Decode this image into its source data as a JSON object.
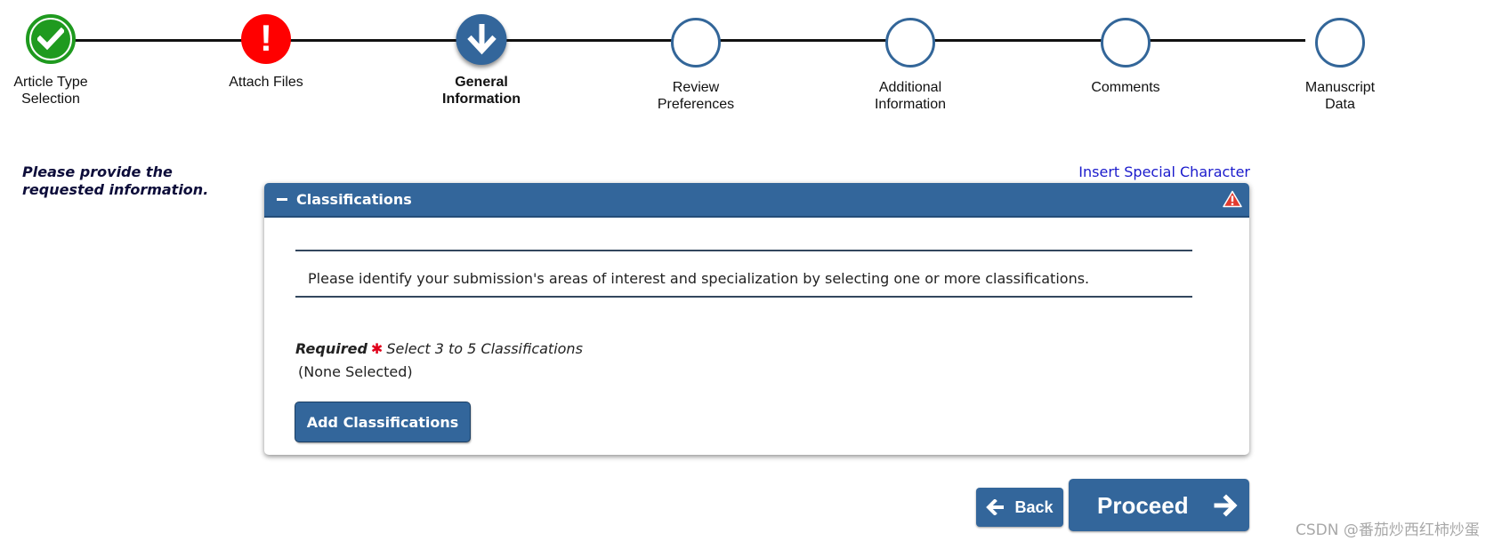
{
  "stepper": {
    "steps": [
      {
        "label_1": "Article Type",
        "label_2": "Selection",
        "status": "complete",
        "icon": "checkmark-icon"
      },
      {
        "label_1": "Attach Files",
        "label_2": "",
        "status": "error",
        "icon": "exclamation-icon"
      },
      {
        "label_1": "General",
        "label_2": "Information",
        "status": "current",
        "icon": "down-arrow-icon"
      },
      {
        "label_1": "Review",
        "label_2": "Preferences",
        "status": "pending",
        "icon": ""
      },
      {
        "label_1": "Additional",
        "label_2": "Information",
        "status": "pending",
        "icon": ""
      },
      {
        "label_1": "Comments",
        "label_2": "",
        "status": "pending",
        "icon": ""
      },
      {
        "label_1": "Manuscript",
        "label_2": "Data",
        "status": "pending",
        "icon": ""
      }
    ]
  },
  "instructions": {
    "line_1": "Please provide the",
    "line_2": "requested information."
  },
  "special_char_link": "Insert Special Character",
  "panel": {
    "title": "Classifications",
    "collapse_icon": "minus-icon",
    "warning_icon": "warning-triangle-icon",
    "description": "Please identify your submission's areas of interest and specialization by selecting one or more classifications.",
    "required_label": "Required",
    "required_marker": "✱",
    "requirement_hint": "Select 3 to 5 Classifications",
    "selection_status": "(None Selected)",
    "add_button": "Add Classifications"
  },
  "navigation": {
    "back_label": "Back",
    "proceed_label": "Proceed"
  },
  "watermark": "CSDN @番茄炒西红柿炒蛋",
  "colors": {
    "primary": "#33669b",
    "success": "#1f9a1f",
    "error": "#ff0000",
    "link": "#1a1acc",
    "required_star": "#e0001a"
  }
}
